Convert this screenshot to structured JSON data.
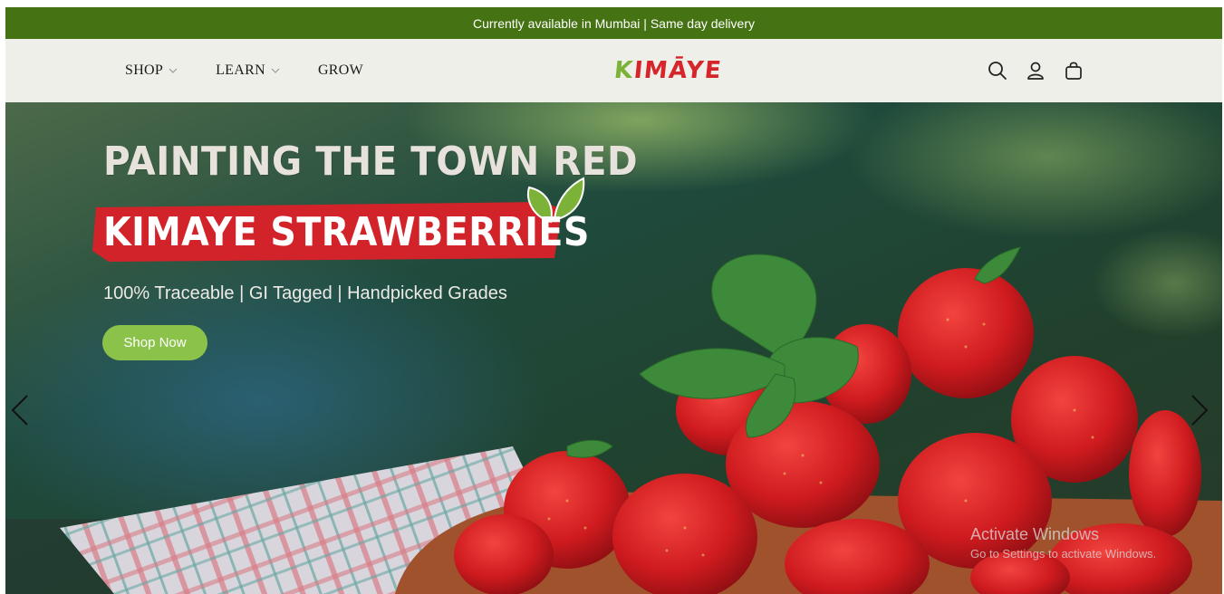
{
  "announcement": "Currently available in Mumbai | Same day delivery",
  "nav": {
    "shop": "SHOP",
    "learn": "LEARN",
    "grow": "GROW"
  },
  "logo": {
    "k": "K",
    "rest": "IMĀYE"
  },
  "icons": [
    "search-icon",
    "user-icon",
    "bag-icon"
  ],
  "hero": {
    "headline": "PAINTING THE TOWN RED",
    "band": "KIMAYE STRAWBERRIES",
    "tagline": "100% Traceable | GI Tagged | Handpicked Grades",
    "cta": "Shop Now"
  },
  "watermark": {
    "title": "Activate Windows",
    "subtitle": "Go to Settings to activate Windows."
  },
  "colors": {
    "announce_bg": "#457212",
    "header_bg": "#efefe9",
    "band_red": "#d3232a",
    "cta_green": "#8bc34a",
    "logo_red": "#d6262b",
    "logo_green": "#7cb238"
  }
}
